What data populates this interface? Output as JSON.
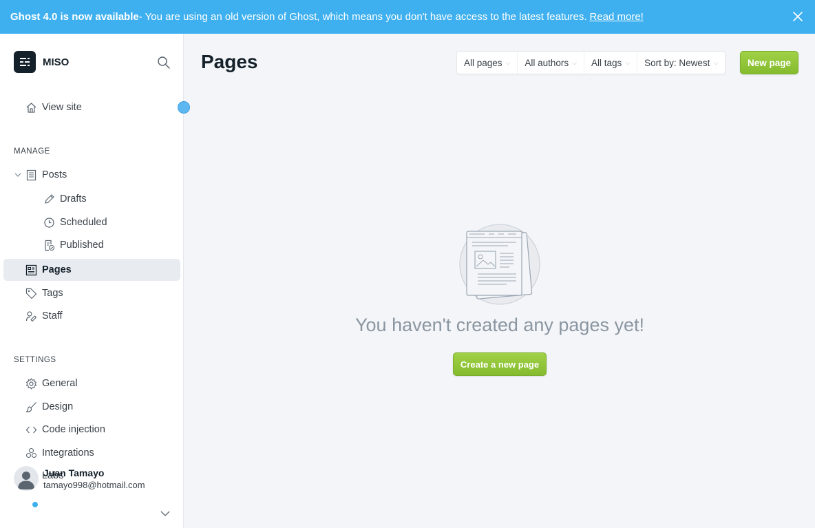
{
  "banner": {
    "title": "Ghost 4.0 is now available",
    "message": " - You are using an old version of Ghost, which means you don't have access to the latest features.",
    "link": "Read more!"
  },
  "sidebar": {
    "brand": "MISO",
    "view_site": "View site",
    "manage_title": "MANAGE",
    "posts": "Posts",
    "drafts": "Drafts",
    "scheduled": "Scheduled",
    "published": "Published",
    "pages": "Pages",
    "tags": "Tags",
    "staff": "Staff",
    "settings_title": "SETTINGS",
    "general": "General",
    "design": "Design",
    "code_injection": "Code injection",
    "integrations": "Integrations",
    "labs": "Labs"
  },
  "user": {
    "name": "Juan Tamayo",
    "email": "tamayo998@hotmail.com"
  },
  "main": {
    "title": "Pages",
    "filters": [
      "All pages",
      "All authors",
      "All tags",
      "Sort by: Newest"
    ],
    "new_page": "New page",
    "empty_text": "You haven't created any pages yet!",
    "create_button": "Create a new page"
  },
  "colors": {
    "banner": "#3eb0ef",
    "green": "#94c83b",
    "sidebar_active": "#e8ebf0"
  }
}
